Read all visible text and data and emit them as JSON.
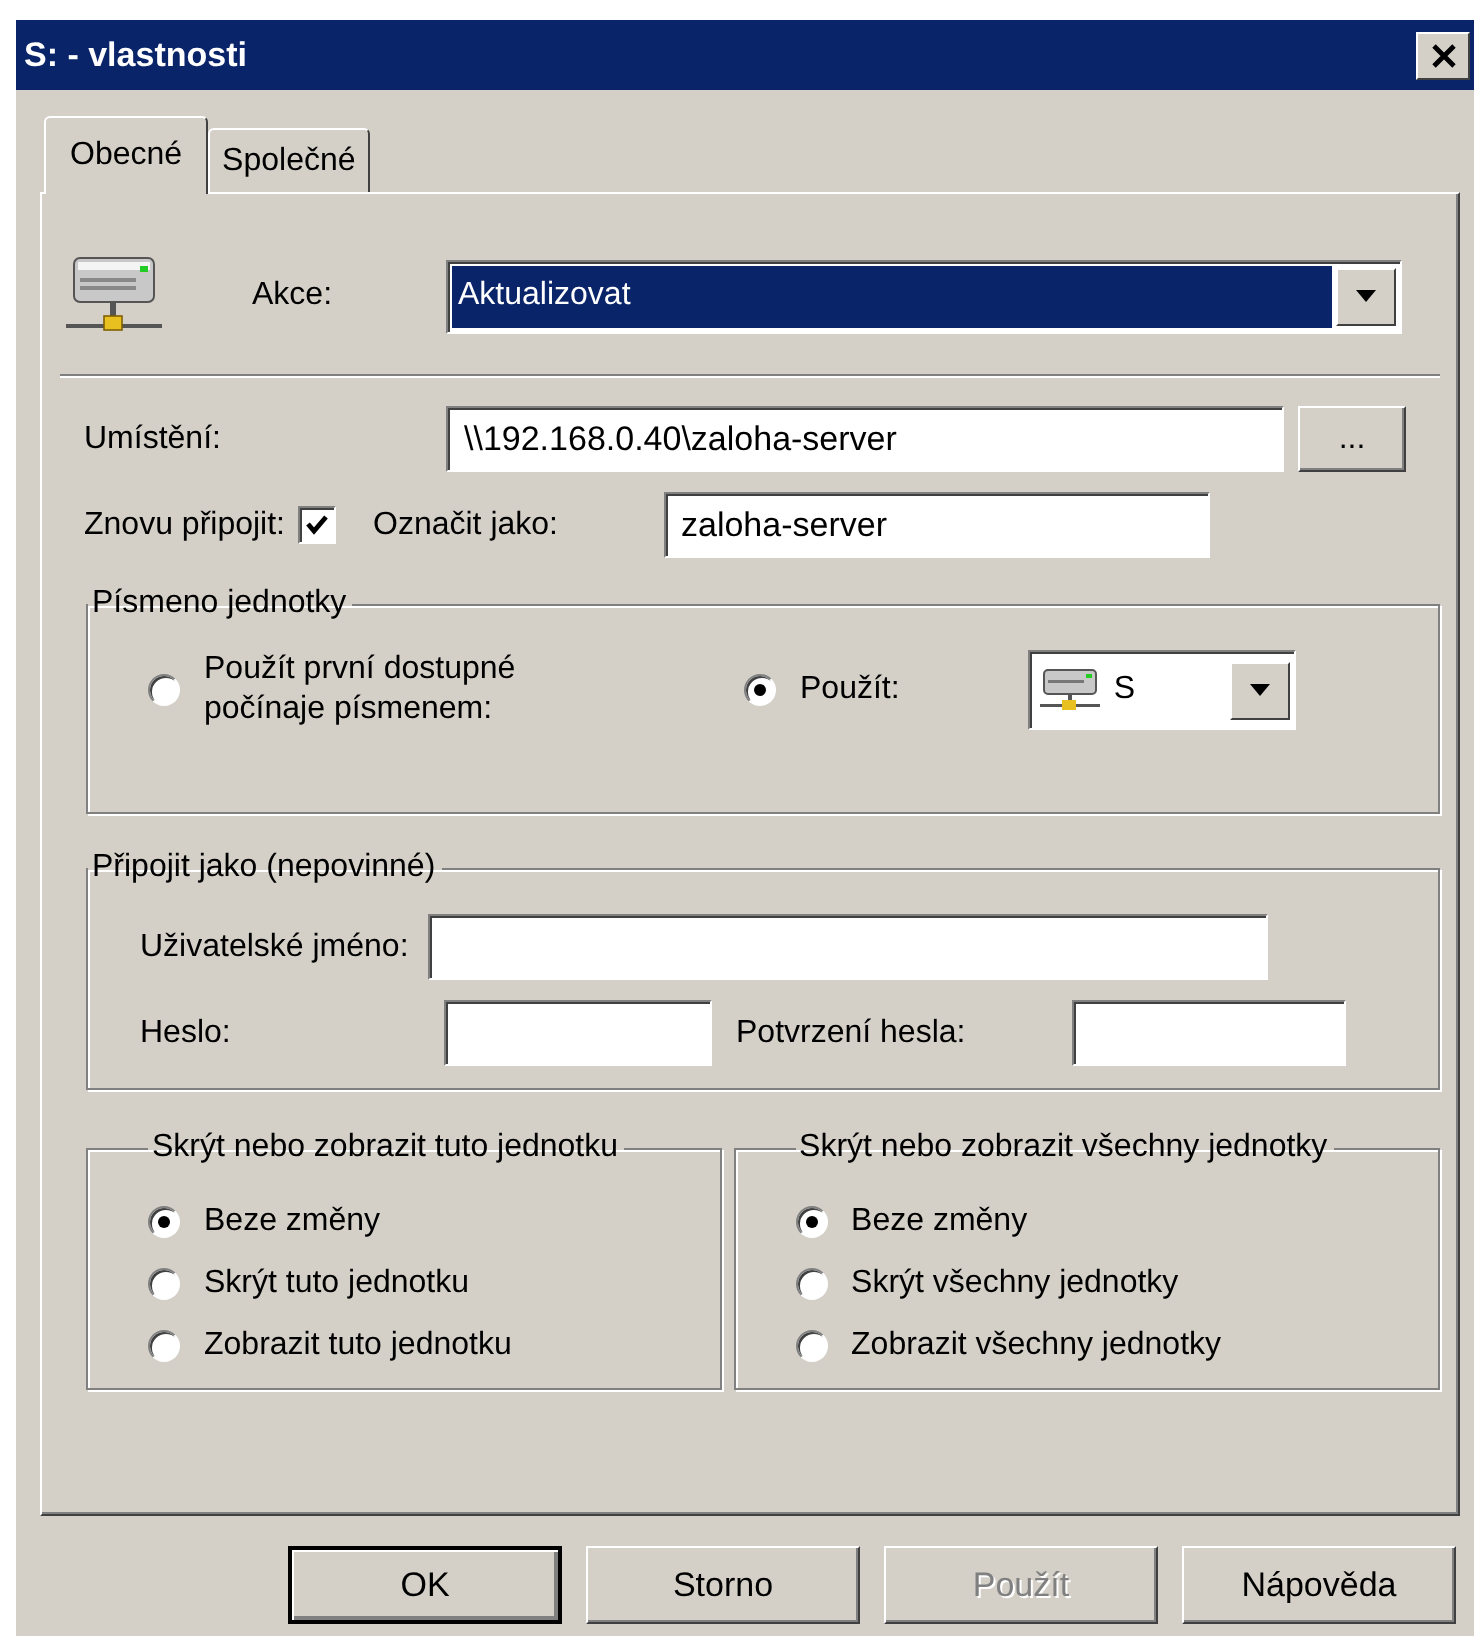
{
  "window": {
    "title": "S: - vlastnosti"
  },
  "tabs": [
    {
      "label": "Obecné",
      "selected": true
    },
    {
      "label": "Společné",
      "selected": false
    }
  ],
  "action": {
    "label": "Akce:",
    "value": "Aktualizovat"
  },
  "location": {
    "label": "Umístění:",
    "value": "\\\\192.168.0.40\\zaloha-server",
    "browse": "..."
  },
  "reconnect": {
    "label": "Znovu připojit:",
    "checked": true
  },
  "label_as": {
    "label": "Označit jako:",
    "value": "zaloha-server"
  },
  "drive_letter": {
    "title": "Písmeno jednotky",
    "letter": "S",
    "options": [
      {
        "label": "Použít první dostupné počínaje písmenem:",
        "selected": false
      },
      {
        "label": "Použít:",
        "selected": true
      }
    ]
  },
  "connect_as": {
    "title": "Připojit jako (nepovinné)",
    "username_label": "Uživatelské jméno:",
    "password_label": "Heslo:",
    "confirm_label": "Potvrzení hesla:"
  },
  "hide_this": {
    "title": "Skrýt nebo zobrazit tuto jednotku",
    "options": [
      {
        "label": "Beze změny",
        "selected": true
      },
      {
        "label": "Skrýt tuto jednotku",
        "selected": false
      },
      {
        "label": "Zobrazit tuto jednotku",
        "selected": false
      }
    ]
  },
  "hide_all": {
    "title": "Skrýt nebo zobrazit všechny jednotky",
    "options": [
      {
        "label": "Beze změny",
        "selected": true
      },
      {
        "label": "Skrýt všechny jednotky",
        "selected": false
      },
      {
        "label": "Zobrazit všechny jednotky",
        "selected": false
      }
    ]
  },
  "buttons": [
    {
      "label": "OK",
      "disabled": false,
      "default": true
    },
    {
      "label": "Storno",
      "disabled": false,
      "default": false
    },
    {
      "label": "Použít",
      "disabled": true,
      "default": false
    },
    {
      "label": "Nápověda",
      "disabled": false,
      "default": false
    }
  ]
}
